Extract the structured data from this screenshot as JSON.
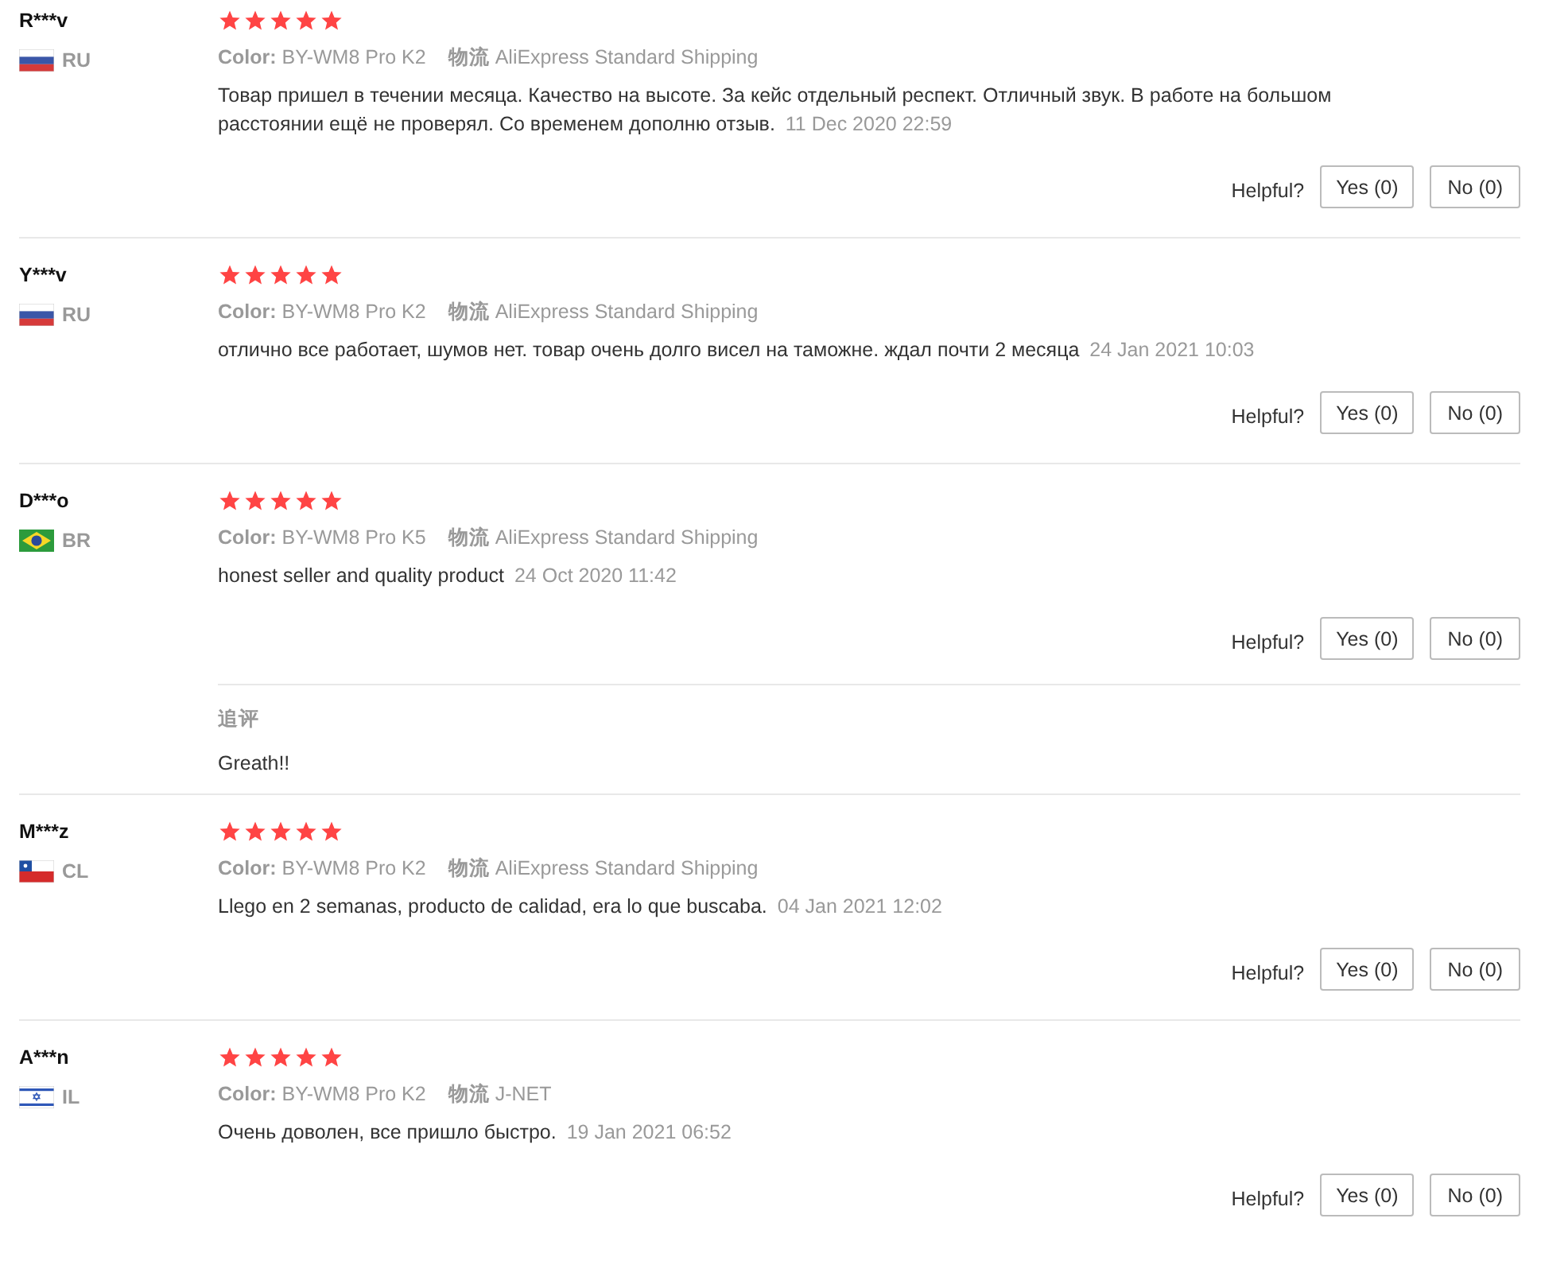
{
  "reviews": [
    {
      "name": "R***v",
      "flag": {
        "kind": "ru"
      },
      "country": "RU",
      "stars": 5,
      "color_label": "Color:",
      "color_value": "BY-WM8 Pro K2",
      "shipping_label": "物流",
      "shipping": "AliExpress Standard Shipping",
      "text": "Товар пришел в течении месяца. Качество на высоте. За кейс отдельный респект. Отличный звук. В работе на большом расстоянии ещё не проверял. Со временем дополню отзыв.",
      "date": "11 Dec 2020 22:59",
      "helpful_label": "Helpful?",
      "yes": "Yes (0)",
      "no": "No (0)"
    },
    {
      "name": "Y***v",
      "flag": {
        "kind": "ru"
      },
      "country": "RU",
      "stars": 5,
      "color_label": "Color:",
      "color_value": "BY-WM8 Pro K2",
      "shipping_label": "物流",
      "shipping": "AliExpress Standard Shipping",
      "text": "отлично все работает, шумов нет. товар очень долго висел на таможне. ждал почти 2 месяца",
      "date": "24 Jan 2021 10:03",
      "helpful_label": "Helpful?",
      "yes": "Yes (0)",
      "no": "No (0)"
    },
    {
      "name": "D***o",
      "flag": {
        "kind": "br"
      },
      "country": "BR",
      "stars": 5,
      "color_label": "Color:",
      "color_value": "BY-WM8 Pro K5",
      "shipping_label": "物流",
      "shipping": "AliExpress Standard Shipping",
      "text": "honest seller and quality product",
      "date": "24 Oct 2020 11:42",
      "helpful_label": "Helpful?",
      "yes": "Yes (0)",
      "no": "No (0)",
      "additional": {
        "label": "追评",
        "text": "Greath!!"
      }
    },
    {
      "name": "M***z",
      "flag": {
        "kind": "cl"
      },
      "country": "CL",
      "stars": 5,
      "color_label": "Color:",
      "color_value": "BY-WM8 Pro K2",
      "shipping_label": "物流",
      "shipping": "AliExpress Standard Shipping",
      "text": "Llego en 2 semanas, producto de calidad, era lo que buscaba.",
      "date": "04 Jan 2021 12:02",
      "helpful_label": "Helpful?",
      "yes": "Yes (0)",
      "no": "No (0)"
    },
    {
      "name": "A***n",
      "flag": {
        "kind": "il"
      },
      "country": "IL",
      "stars": 5,
      "color_label": "Color:",
      "color_value": "BY-WM8 Pro K2",
      "shipping_label": "物流",
      "shipping": "J-NET",
      "text": "Очень доволен, все пришло быстро.",
      "date": "19 Jan 2021 06:52",
      "helpful_label": "Helpful?",
      "yes": "Yes (0)",
      "no": "No (0)"
    }
  ]
}
